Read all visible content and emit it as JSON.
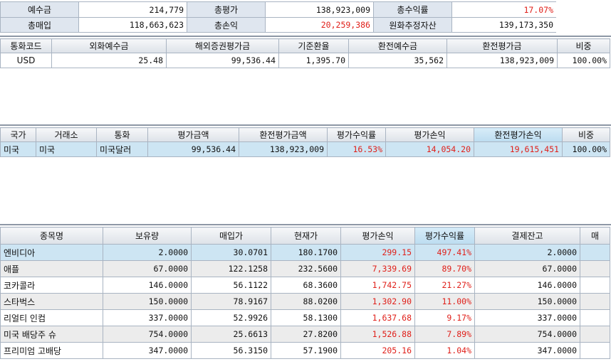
{
  "summary": {
    "deposit_label": "예수금",
    "deposit_value": "214,779",
    "total_eval_label": "총평가",
    "total_eval_value": "138,923,009",
    "total_return_label": "총수익률",
    "total_return_value": "17.07%",
    "total_buy_label": "총매입",
    "total_buy_value": "118,663,623",
    "total_pl_label": "총손익",
    "total_pl_value": "20,259,386",
    "krw_assets_label": "원화추정자산",
    "krw_assets_value": "139,173,350"
  },
  "currency_table": {
    "headers": [
      "통화코드",
      "외화예수금",
      "해외증권평가금",
      "기준환율",
      "환전예수금",
      "환전평가금",
      "비중"
    ],
    "rows": [
      [
        "USD",
        "25.48",
        "99,536.44",
        "1,395.70",
        "35,562",
        "138,923,009",
        "100.00%"
      ]
    ]
  },
  "country_table": {
    "headers": [
      "국가",
      "거래소",
      "통화",
      "평가금액",
      "환전평가금액",
      "평가수익률",
      "평가손익",
      "환전평가손익",
      "비중"
    ],
    "rows": [
      [
        "미국",
        "미국",
        "미국달러",
        "99,536.44",
        "138,923,009",
        "16.53%",
        "14,054.20",
        "19,615,451",
        "100.00%"
      ]
    ]
  },
  "stock_table": {
    "headers": [
      "종목명",
      "보유량",
      "매입가",
      "현재가",
      "평가손익",
      "평가수익률",
      "결제잔고",
      "매"
    ],
    "rows": [
      [
        "엔비디아",
        "2.0000",
        "30.0701",
        "180.1700",
        "299.15",
        "497.41%",
        "2.0000"
      ],
      [
        "애플",
        "67.0000",
        "122.1258",
        "232.5600",
        "7,339.69",
        "89.70%",
        "67.0000"
      ],
      [
        "코카콜라",
        "146.0000",
        "56.1122",
        "68.3600",
        "1,742.75",
        "21.27%",
        "146.0000"
      ],
      [
        "스타벅스",
        "150.0000",
        "78.9167",
        "88.0200",
        "1,302.90",
        "11.00%",
        "150.0000"
      ],
      [
        "리얼티 인컴",
        "337.0000",
        "52.9926",
        "58.1300",
        "1,637.68",
        "9.17%",
        "337.0000"
      ],
      [
        "미국 배당주 슈",
        "754.0000",
        "25.6613",
        "27.8200",
        "1,526.88",
        "7.89%",
        "754.0000"
      ],
      [
        "프리미엄 고배당",
        "347.0000",
        "56.3150",
        "57.1900",
        "205.16",
        "1.04%",
        "347.0000"
      ]
    ]
  },
  "colors": {
    "positive": "#e0201a",
    "selected_row": "#cde5f3",
    "label_bg": "#dfe6ef",
    "alt_row": "#ececec"
  }
}
